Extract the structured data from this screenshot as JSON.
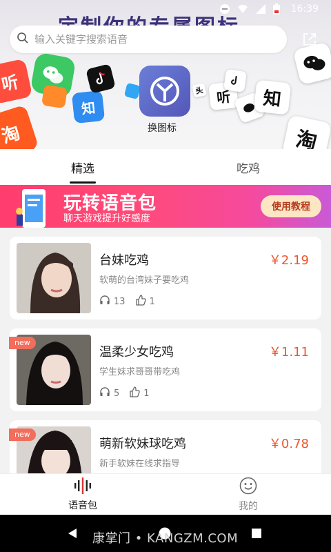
{
  "status_bar": {
    "time": "16:39"
  },
  "hero": {
    "banner_title": "定制你的专属图标",
    "app_label": "换图标",
    "tiles": [
      "听",
      "知",
      "淘",
      "听",
      "知",
      "淘"
    ]
  },
  "search": {
    "placeholder": "输入关键字搜索语音"
  },
  "tabs": [
    {
      "label": "精选",
      "active": true
    },
    {
      "label": "吃鸡",
      "active": false
    }
  ],
  "promo": {
    "title": "玩转语音包",
    "subtitle": "聊天游戏提升好感度",
    "button": "使用教程"
  },
  "packs": [
    {
      "title": "台妹吃鸡",
      "desc": "软萌的台湾妹子要吃鸡",
      "price": "￥2.19",
      "listens": "13",
      "likes": "1",
      "is_new": false
    },
    {
      "title": "温柔少女吃鸡",
      "desc": "学生妹求哥哥带吃鸡",
      "price": "￥1.11",
      "listens": "5",
      "likes": "1",
      "is_new": true
    },
    {
      "title": "萌新软妹球吃鸡",
      "desc": "新手软妹在线求指导",
      "price": "￥0.78",
      "listens": "",
      "likes": "",
      "is_new": true
    }
  ],
  "badge_new": "new",
  "bottom_nav": [
    {
      "label": "语音包",
      "icon": "soundwave-icon",
      "active": true
    },
    {
      "label": "我的",
      "icon": "smiley-icon",
      "active": false
    }
  ],
  "watermark": "康掌门 • KANGZM.COM",
  "colors": {
    "accent_price": "#f0552d",
    "promo_start": "#ff3d6e",
    "promo_end": "#c95ad6",
    "badge_new": "#f26d5b"
  }
}
